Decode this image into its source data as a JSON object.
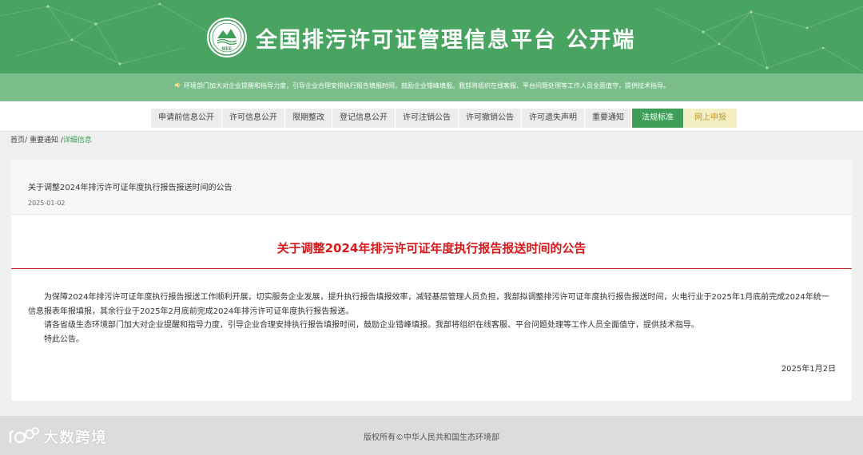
{
  "header": {
    "site_title": "全国排污许可证管理信息平台  公开端",
    "logo_text": "MEE"
  },
  "notice": {
    "text": "环境部门加大对企业提醒和指导力度，引导企业合理安排执行报告填报时间，鼓励企业错峰填报。我部将组织在线客服、平台问题处理等工作人员全面值守，提供技术指导。"
  },
  "nav": {
    "items": [
      {
        "label": "申请前信息公开"
      },
      {
        "label": "许可信息公开"
      },
      {
        "label": "限期整改"
      },
      {
        "label": "登记信息公开"
      },
      {
        "label": "许可注销公告"
      },
      {
        "label": "许可撤销公告"
      },
      {
        "label": "许可遗失声明"
      },
      {
        "label": "重要通知"
      },
      {
        "label": "法规标准"
      },
      {
        "label": "网上申报"
      }
    ],
    "active": "法规标准"
  },
  "breadcrumb": {
    "home": "首页",
    "sep1": "/",
    "section": "重要通知",
    "sep2": "/",
    "current": "详细信息"
  },
  "article": {
    "head_title": "关于调整2024年排污许可证年度执行报告报送时间的公告",
    "head_date": "2025-01-02",
    "title": "关于调整2024年排污许可证年度执行报告报送时间的公告",
    "paragraphs": [
      "为保障2024年排污许可证年度执行报告报送工作顺利开展，切实服务企业发展，提升执行报告填报效率，减轻基层管理人员负担，我部拟调整排污许可证年度执行报告报送时间，火电行业于2025年1月底前完成2024年统一信息报表年报填报，其余行业于2025年2月底前完成2024年排污许可证年度执行报告报送。",
      "请各省级生态环境部门加大对企业提醒和指导力度，引导企业合理安排执行报告填报时间，鼓励企业错峰填报。我部将组织在线客服、平台问题处理等工作人员全面值守，提供技术指导。",
      "特此公告。"
    ],
    "sign_date": "2025年1月2日"
  },
  "footer": {
    "copyright": "版权所有©中华人民共和国生态环境部"
  },
  "watermark": {
    "text": "大数跨境"
  },
  "colors": {
    "header_green": "#4aa461",
    "notice_green": "#7bbd8a",
    "nav_active": "#3f9e57",
    "title_red": "#d7191b",
    "declare_bg": "#f4eec4",
    "declare_text": "#c69a22"
  }
}
